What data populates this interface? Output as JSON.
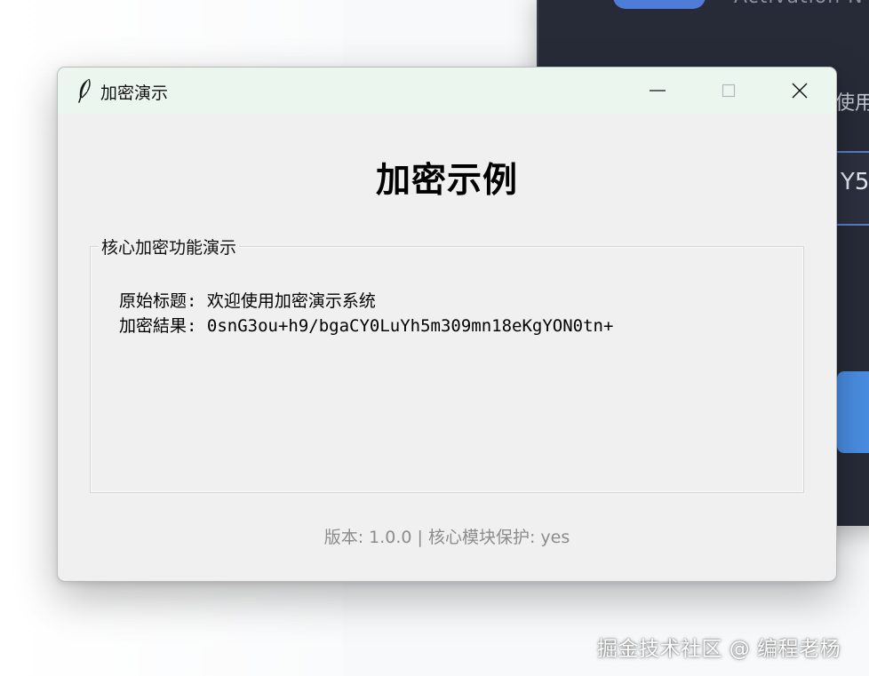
{
  "background_window": {
    "title_fragment": "Activation N",
    "text_fragment": "使用",
    "input_fragment": "Y5",
    "accent_color": "#4a8ee3"
  },
  "window": {
    "icon": "feather-icon",
    "title": "加密演示",
    "controls": {
      "minimize": "minimize-icon",
      "maximize": "maximize-icon",
      "close": "close-icon"
    }
  },
  "main": {
    "heading": "加密示例",
    "group_title": "核心加密功能演示",
    "original_line": "原始标题: 欢迎使用加密演示系统",
    "encrypted_line": "加密結果: 0snG3ou+h9/bgaCY0LuYh5m309mn18eKgYON0tn+"
  },
  "footer": {
    "version_text": "版本: 1.0.0 | 核心模块保护: yes"
  },
  "watermark": {
    "text": "掘金技术社区 @ 编程老杨"
  }
}
